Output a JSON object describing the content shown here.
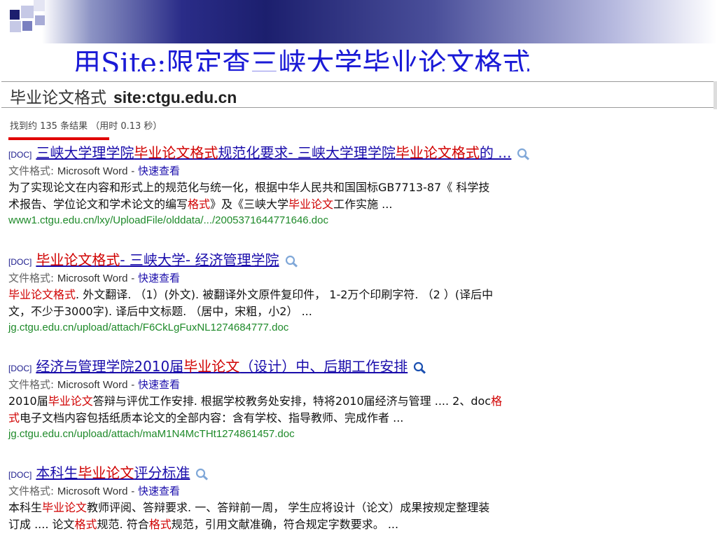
{
  "slide": {
    "title": "用Site:限定查三峡大学毕业论文格式",
    "colors": {
      "title": "#1a1ad6",
      "header_dark": "#1c1f6e",
      "underline": "#e00000"
    }
  },
  "search": {
    "query": "毕业论文格式",
    "site_operator": "site:ctgu.edu.cn",
    "stats": "找到约 135 条结果 （用时 0.13 秒）"
  },
  "results": [
    {
      "tag": "[DOC]",
      "title_parts": [
        {
          "text": "三峡大学理学院",
          "hl": false
        },
        {
          "text": "毕业论文格式",
          "hl": true
        },
        {
          "text": "规范化要求- 三峡大学理学院",
          "hl": false
        },
        {
          "text": "毕业论文格式",
          "hl": true
        },
        {
          "text": "的 ...",
          "hl": false
        }
      ],
      "format_label": "文件格式:",
      "format_app": "Microsoft Word",
      "quick_view": "快速查看",
      "snippet_lines": [
        [
          {
            "text": "为了实现论文在内容和形式上的规范化与统一化，根据中华人民共和国国标GB7713-87《 科学技",
            "hl": false
          }
        ],
        [
          {
            "text": "术报告、学位论文和学术论文的编写",
            "hl": false
          },
          {
            "text": "格式",
            "hl": true
          },
          {
            "text": "》及《三峡大学",
            "hl": false
          },
          {
            "text": "毕业论文",
            "hl": true
          },
          {
            "text": "工作实施 ...",
            "hl": false
          }
        ]
      ],
      "url": "www1.ctgu.edu.cn/lxy/UploadFile/olddata/.../2005371644771646.doc"
    },
    {
      "tag": "[DOC]",
      "title_parts": [
        {
          "text": "毕业论文格式",
          "hl": true
        },
        {
          "text": "- 三峡大学- 经济管理学院",
          "hl": false
        }
      ],
      "format_label": "文件格式:",
      "format_app": "Microsoft Word",
      "quick_view": "快速查看",
      "snippet_lines": [
        [
          {
            "text": "毕业论文格式",
            "hl": true
          },
          {
            "text": ". 外文翻译. （1）(外文). 被翻译外文原件复印件， 1-2万个印刷字符. （2 ）(译后中",
            "hl": false
          }
        ],
        [
          {
            "text": "文，不少于3000字). 译后中文标题. （居中，宋粗，小2） ...",
            "hl": false
          }
        ]
      ],
      "url": "jg.ctgu.edu.cn/upload/attach/F6CkLgFuxNL1274684777.doc"
    },
    {
      "tag": "[DOC]",
      "title_parts": [
        {
          "text": "经济与管理学院2010届",
          "hl": false
        },
        {
          "text": "毕业论文",
          "hl": true
        },
        {
          "text": "（设计）中、后期工作安排",
          "hl": false
        }
      ],
      "format_label": "文件格式:",
      "format_app": "Microsoft Word",
      "quick_view": "快速查看",
      "snippet_lines": [
        [
          {
            "text": "2010届",
            "hl": false
          },
          {
            "text": "毕业论文",
            "hl": true
          },
          {
            "text": "答辩与评优工作安排. 根据学校教务处安排，特将2010届经济与管理 .... 2、doc",
            "hl": false
          },
          {
            "text": "格",
            "hl": true
          }
        ],
        [
          {
            "text": "式",
            "hl": true
          },
          {
            "text": "电子文档内容包括纸质本论文的全部内容：含有学校、指导教师、完成作者 ...",
            "hl": false
          }
        ]
      ],
      "url": "jg.ctgu.edu.cn/upload/attach/maM1N4McTHt1274861457.doc"
    },
    {
      "tag": "[DOC]",
      "title_parts": [
        {
          "text": "本科生",
          "hl": false
        },
        {
          "text": "毕业论文",
          "hl": true
        },
        {
          "text": "评分标准",
          "hl": false
        }
      ],
      "format_label": "文件格式:",
      "format_app": "Microsoft Word",
      "quick_view": "快速查看",
      "snippet_lines": [
        [
          {
            "text": "本科生",
            "hl": false
          },
          {
            "text": "毕业论文",
            "hl": true
          },
          {
            "text": "教师评阅、答辩要求. 一、答辩前一周， 学生应将设计（论文）成果按规定整理装",
            "hl": false
          }
        ],
        [
          {
            "text": "订成 .... 论文",
            "hl": false
          },
          {
            "text": "格式",
            "hl": true
          },
          {
            "text": "规范. 符合",
            "hl": false
          },
          {
            "text": "格式",
            "hl": true
          },
          {
            "text": "规范，引用文献准确，符合规定字数要求。 ...",
            "hl": false
          }
        ]
      ],
      "url": ""
    }
  ]
}
